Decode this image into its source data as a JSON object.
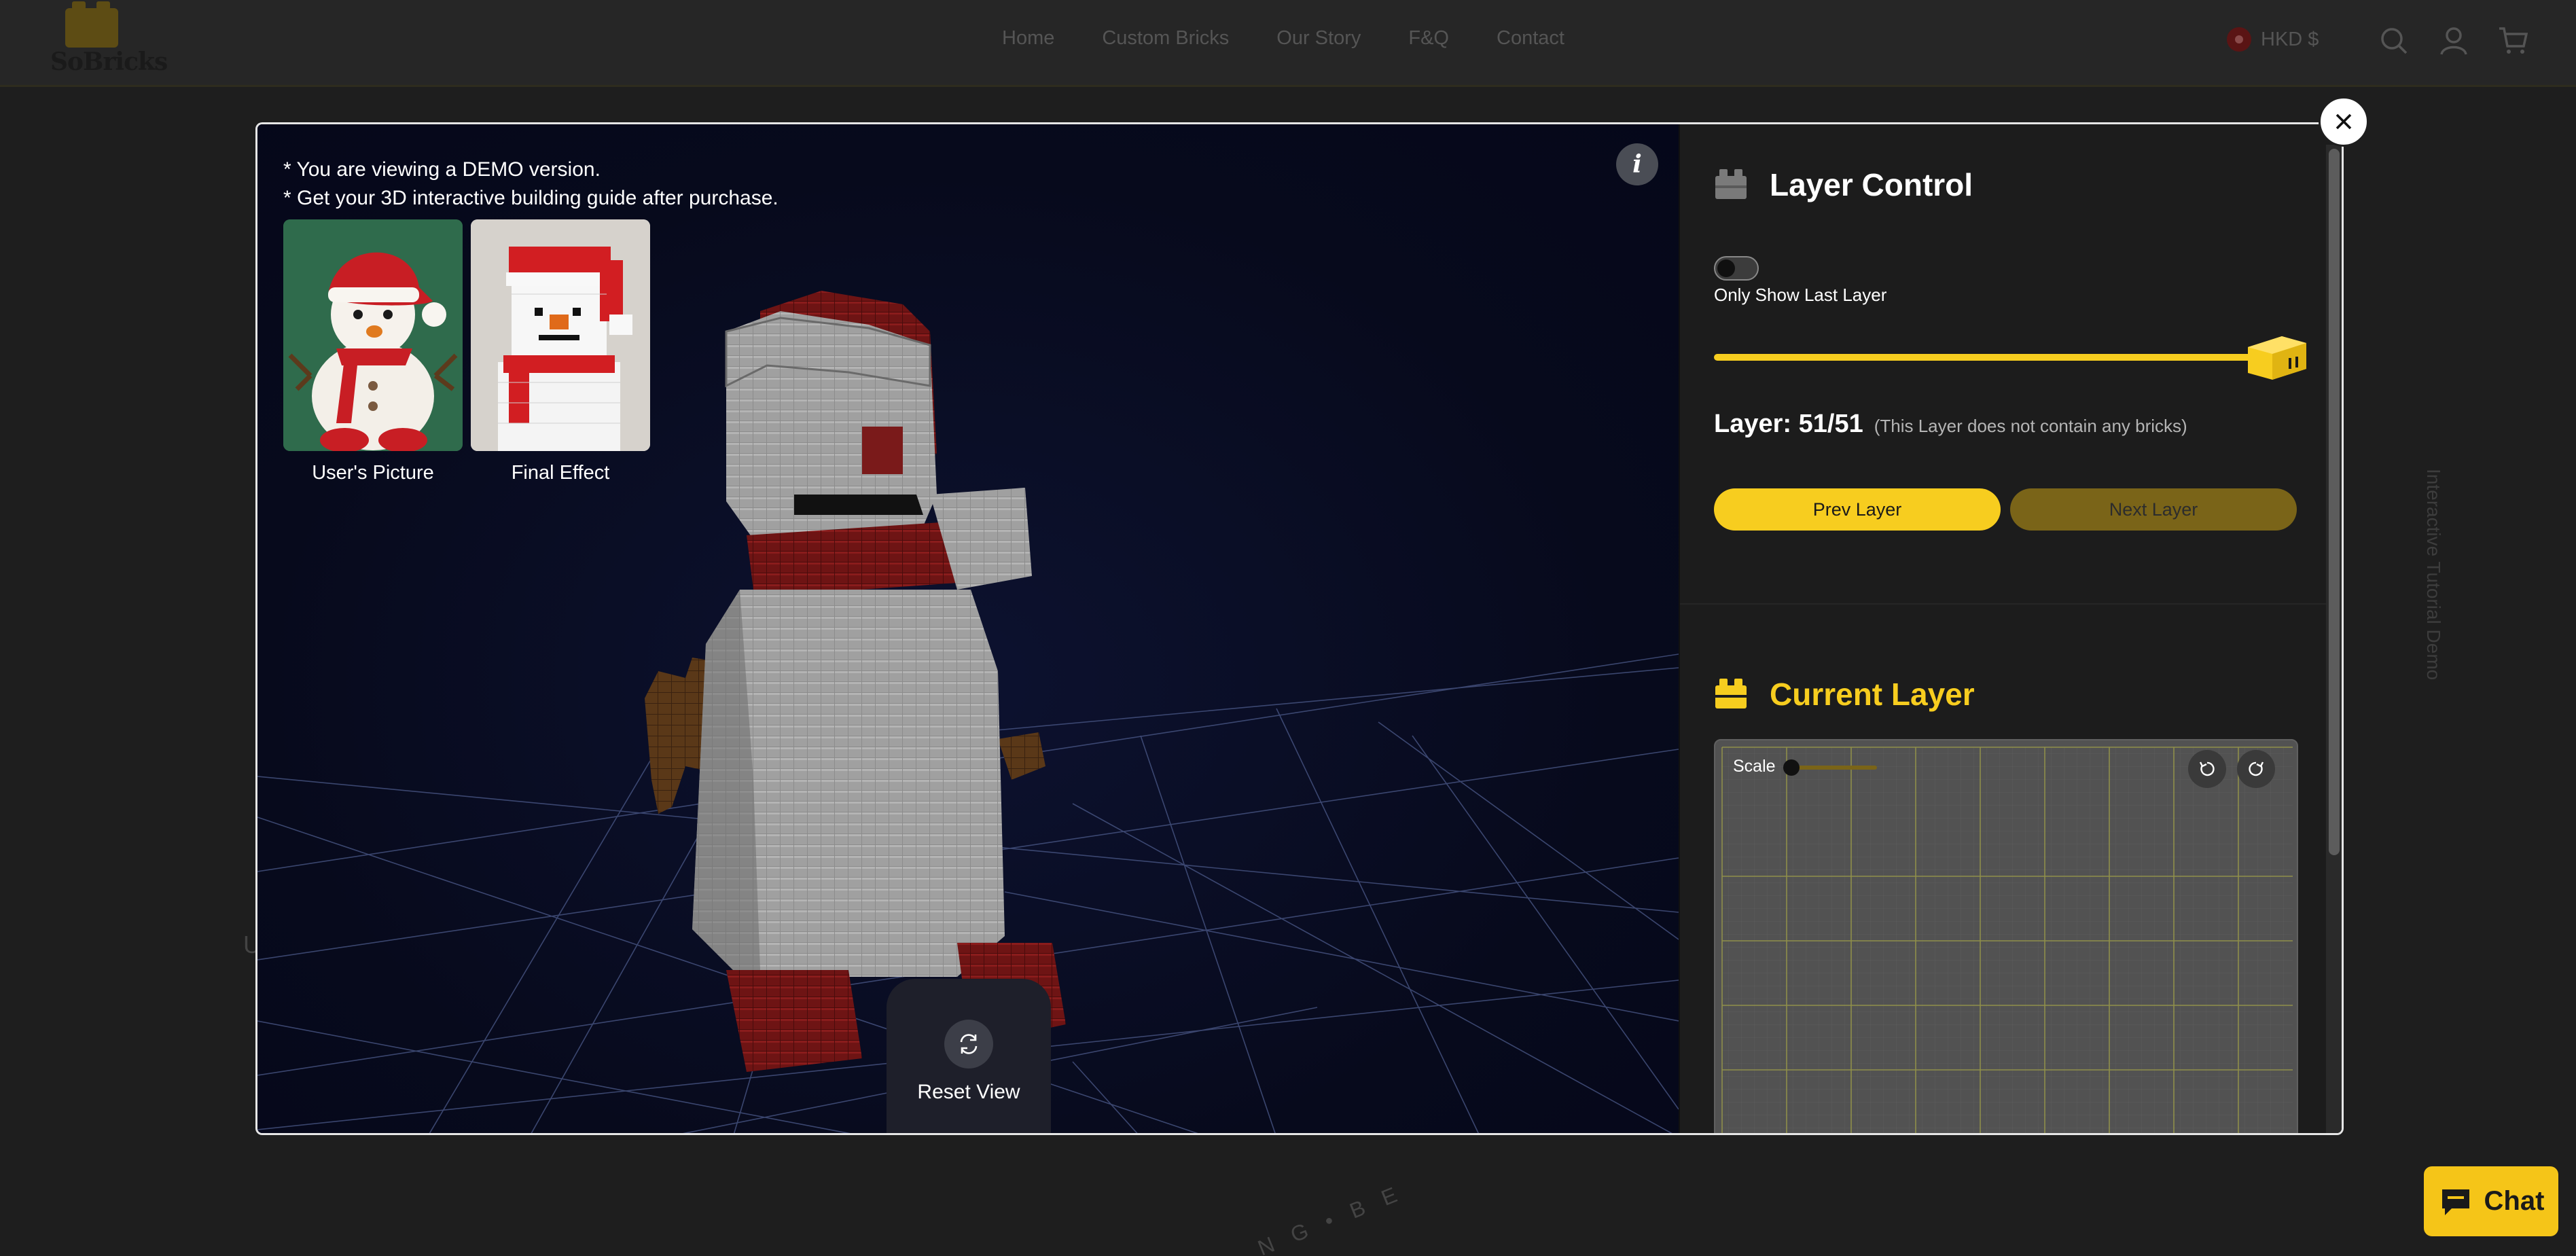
{
  "header": {
    "logo_text": "SoBricks",
    "nav": [
      "Home",
      "Custom Bricks",
      "Our Story",
      "F&Q",
      "Contact"
    ],
    "currency": "HKD $",
    "icons": [
      "search-icon",
      "account-icon",
      "cart-icon"
    ]
  },
  "background": {
    "side_tab": "Interactive Tutorial Demo",
    "circle_text": "N G • B E",
    "stray_letter": "U"
  },
  "chat": {
    "label": "Chat"
  },
  "viewer": {
    "demo_line1": "* You are viewing a DEMO version.",
    "demo_line2": "* Get your 3D interactive building guide after purchase.",
    "info_label": "i",
    "thumbnails": [
      {
        "label": "User's Picture"
      },
      {
        "label": "Final Effect"
      }
    ],
    "reset_label": "Reset View"
  },
  "panel": {
    "layer_control": {
      "title": "Layer Control",
      "toggle_label": "Only Show Last Layer",
      "toggle_on": false,
      "slider_progress": 1.0,
      "layer_text": "Layer: 51/51",
      "layer_note": "(This Layer does not contain any bricks)",
      "prev_label": "Prev Layer",
      "next_label": "Next Layer"
    },
    "current_layer": {
      "title": "Current Layer",
      "scale_label": "Scale",
      "scale_value": 0.0
    }
  },
  "colors": {
    "accent": "#f7cd1f",
    "accent_dim": "#7a6418",
    "panel_bg": "#1c1c1c",
    "viewer_bg": "#090c1c"
  }
}
